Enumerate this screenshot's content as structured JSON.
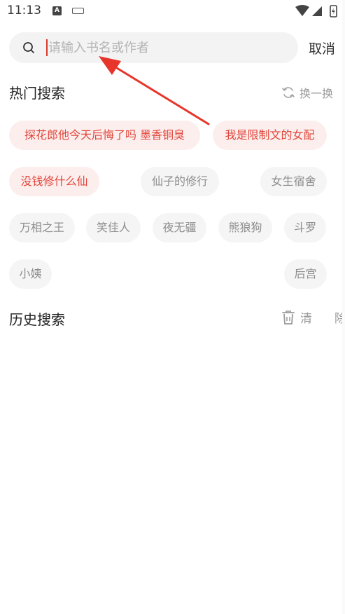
{
  "status_bar": {
    "time": "11:13",
    "a_badge": "A"
  },
  "search": {
    "placeholder": "请输入书名或作者",
    "value": "",
    "cancel_label": "取消"
  },
  "hot": {
    "title": "热门搜索",
    "refresh_label": "换一换",
    "tags": [
      {
        "label": "探花郎他今天后悔了吗 墨香铜臭",
        "hot": true
      },
      {
        "label": "我是限制文的女配",
        "hot": true
      },
      {
        "label": "没钱修什么仙",
        "hot": true
      },
      {
        "label": "仙子的修行",
        "hot": false
      },
      {
        "label": "女生宿舍",
        "hot": false
      },
      {
        "label": "万相之王",
        "hot": false
      },
      {
        "label": "笑佳人",
        "hot": false
      },
      {
        "label": "夜无疆",
        "hot": false
      },
      {
        "label": "熊狼狗",
        "hot": false
      },
      {
        "label": "斗罗",
        "hot": false
      },
      {
        "label": "小姨",
        "hot": false
      },
      {
        "label": "后宫",
        "hot": false
      }
    ]
  },
  "history": {
    "title": "历史搜索",
    "clear_label_1": "清",
    "clear_label_2": "除"
  },
  "colors": {
    "accent": "#e0463a",
    "hot_bg": "#fdeeee",
    "tag_bg": "#f5f5f5",
    "arrow": "#e8352b"
  }
}
